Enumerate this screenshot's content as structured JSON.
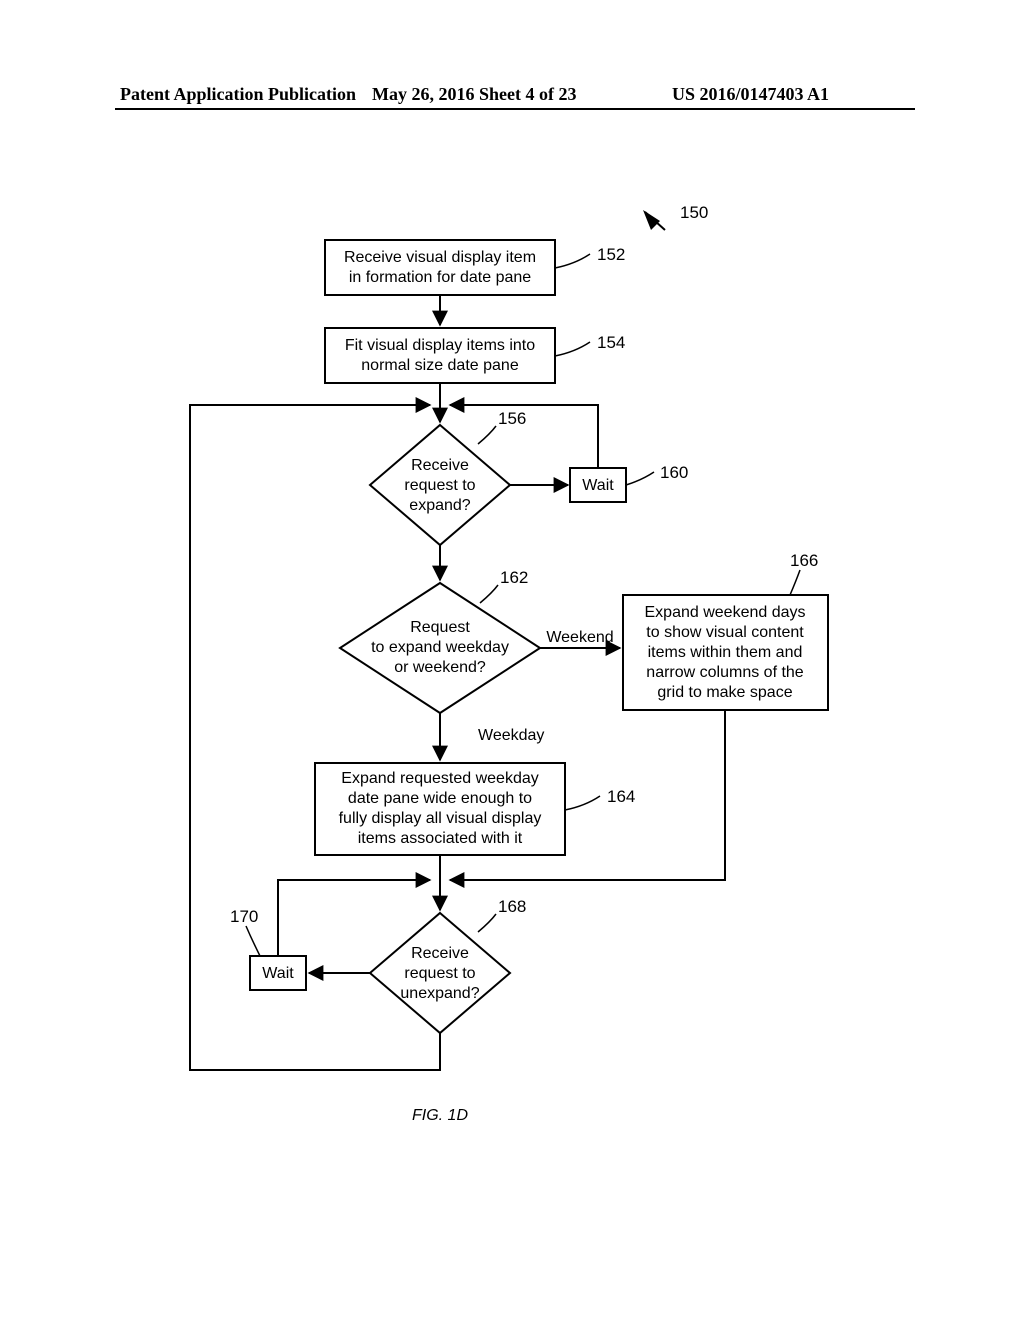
{
  "header": {
    "left": "Patent Application Publication",
    "center": "May 26, 2016  Sheet 4 of 23",
    "right": "US 2016/0147403 A1"
  },
  "refs": {
    "overall": "150",
    "b152": "152",
    "b154": "154",
    "d156": "156",
    "b160": "160",
    "d162": "162",
    "b164": "164",
    "b166": "166",
    "d168": "168",
    "b170": "170"
  },
  "nodes": {
    "b152_l1": "Receive visual display item",
    "b152_l2": "in formation for date pane",
    "b154_l1": "Fit visual display items into",
    "b154_l2": "normal size date pane",
    "d156_l1": "Receive",
    "d156_l2": "request to",
    "d156_l3": "expand?",
    "b160": "Wait",
    "d162_l1": "Request",
    "d162_l2": "to expand weekday",
    "d162_l3": "or weekend?",
    "b164_l1": "Expand requested weekday",
    "b164_l2": "date pane wide enough to",
    "b164_l3": "fully display all visual display",
    "b164_l4": "items associated with it",
    "b166_l1": "Expand weekend days",
    "b166_l2": "to show visual content",
    "b166_l3": "items within them and",
    "b166_l4": "narrow columns of the",
    "b166_l5": "grid to make space",
    "d168_l1": "Receive",
    "d168_l2": "request to",
    "d168_l3": "unexpand?",
    "b170": "Wait"
  },
  "edges": {
    "d162_right": "Weekend",
    "d162_down": "Weekday"
  },
  "figure_caption": "FIG. 1D"
}
